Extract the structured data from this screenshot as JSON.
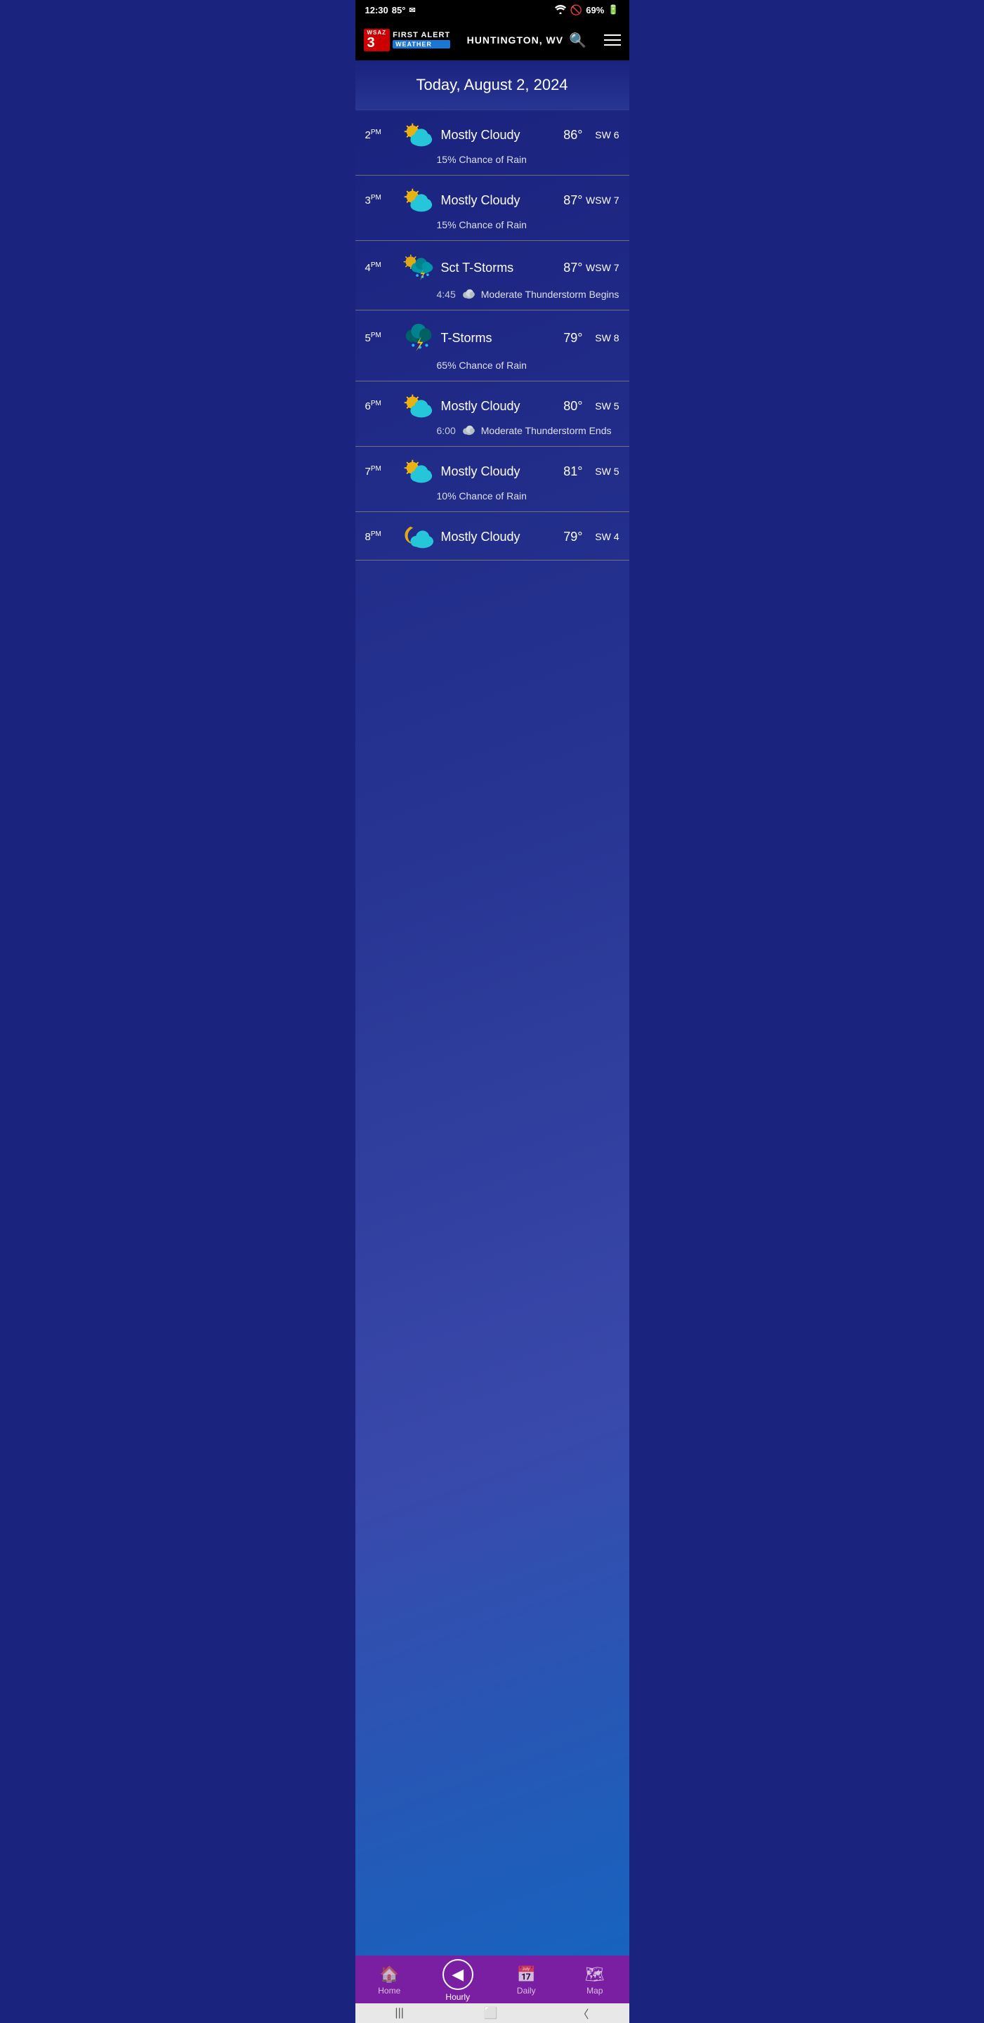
{
  "statusBar": {
    "time": "12:30",
    "temp": "85°",
    "battery": "69%"
  },
  "header": {
    "location": "HUNTINGTON, WV",
    "logoNum": "3",
    "logoFirst": "WSAZ",
    "logoAlert": "FIRST ALERT",
    "logoWeather": "WEATHER"
  },
  "dateHeader": {
    "text": "Today, August 2, 2024"
  },
  "hourlyRows": [
    {
      "time": "2",
      "period": "PM",
      "iconType": "mostly-cloudy-sun",
      "description": "Mostly Cloudy",
      "temp": "86°",
      "wind": "SW 6",
      "subText": "15% Chance of Rain",
      "alertTime": null,
      "alertText": null
    },
    {
      "time": "3",
      "period": "PM",
      "iconType": "mostly-cloudy-sun",
      "description": "Mostly Cloudy",
      "temp": "87°",
      "wind": "WSW 7",
      "subText": "15% Chance of Rain",
      "alertTime": null,
      "alertText": null
    },
    {
      "time": "4",
      "period": "PM",
      "iconType": "sct-tstorms",
      "description": "Sct T-Storms",
      "temp": "87°",
      "wind": "WSW 7",
      "subText": null,
      "alertTime": "4:45",
      "alertText": "Moderate Thunderstorm Begins"
    },
    {
      "time": "5",
      "period": "PM",
      "iconType": "tstorms",
      "description": "T-Storms",
      "temp": "79°",
      "wind": "SW 8",
      "subText": "65% Chance of Rain",
      "alertTime": null,
      "alertText": null
    },
    {
      "time": "6",
      "period": "PM",
      "iconType": "mostly-cloudy-sun",
      "description": "Mostly Cloudy",
      "temp": "80°",
      "wind": "SW 5",
      "subText": null,
      "alertTime": "6:00",
      "alertText": "Moderate Thunderstorm Ends"
    },
    {
      "time": "7",
      "period": "PM",
      "iconType": "mostly-cloudy-sun",
      "description": "Mostly Cloudy",
      "temp": "81°",
      "wind": "SW 5",
      "subText": "10% Chance of Rain",
      "alertTime": null,
      "alertText": null
    },
    {
      "time": "8",
      "period": "PM",
      "iconType": "mostly-cloudy-night",
      "description": "Mostly Cloudy",
      "temp": "79°",
      "wind": "SW 4",
      "subText": null,
      "alertTime": null,
      "alertText": null
    }
  ],
  "bottomNav": {
    "items": [
      {
        "id": "home",
        "label": "Home",
        "icon": "🏠",
        "active": false
      },
      {
        "id": "hourly",
        "label": "Hourly",
        "icon": "◀",
        "active": true
      },
      {
        "id": "daily",
        "label": "Daily",
        "icon": "📅",
        "active": false
      },
      {
        "id": "map",
        "label": "Map",
        "icon": "🗺",
        "active": false
      }
    ]
  }
}
